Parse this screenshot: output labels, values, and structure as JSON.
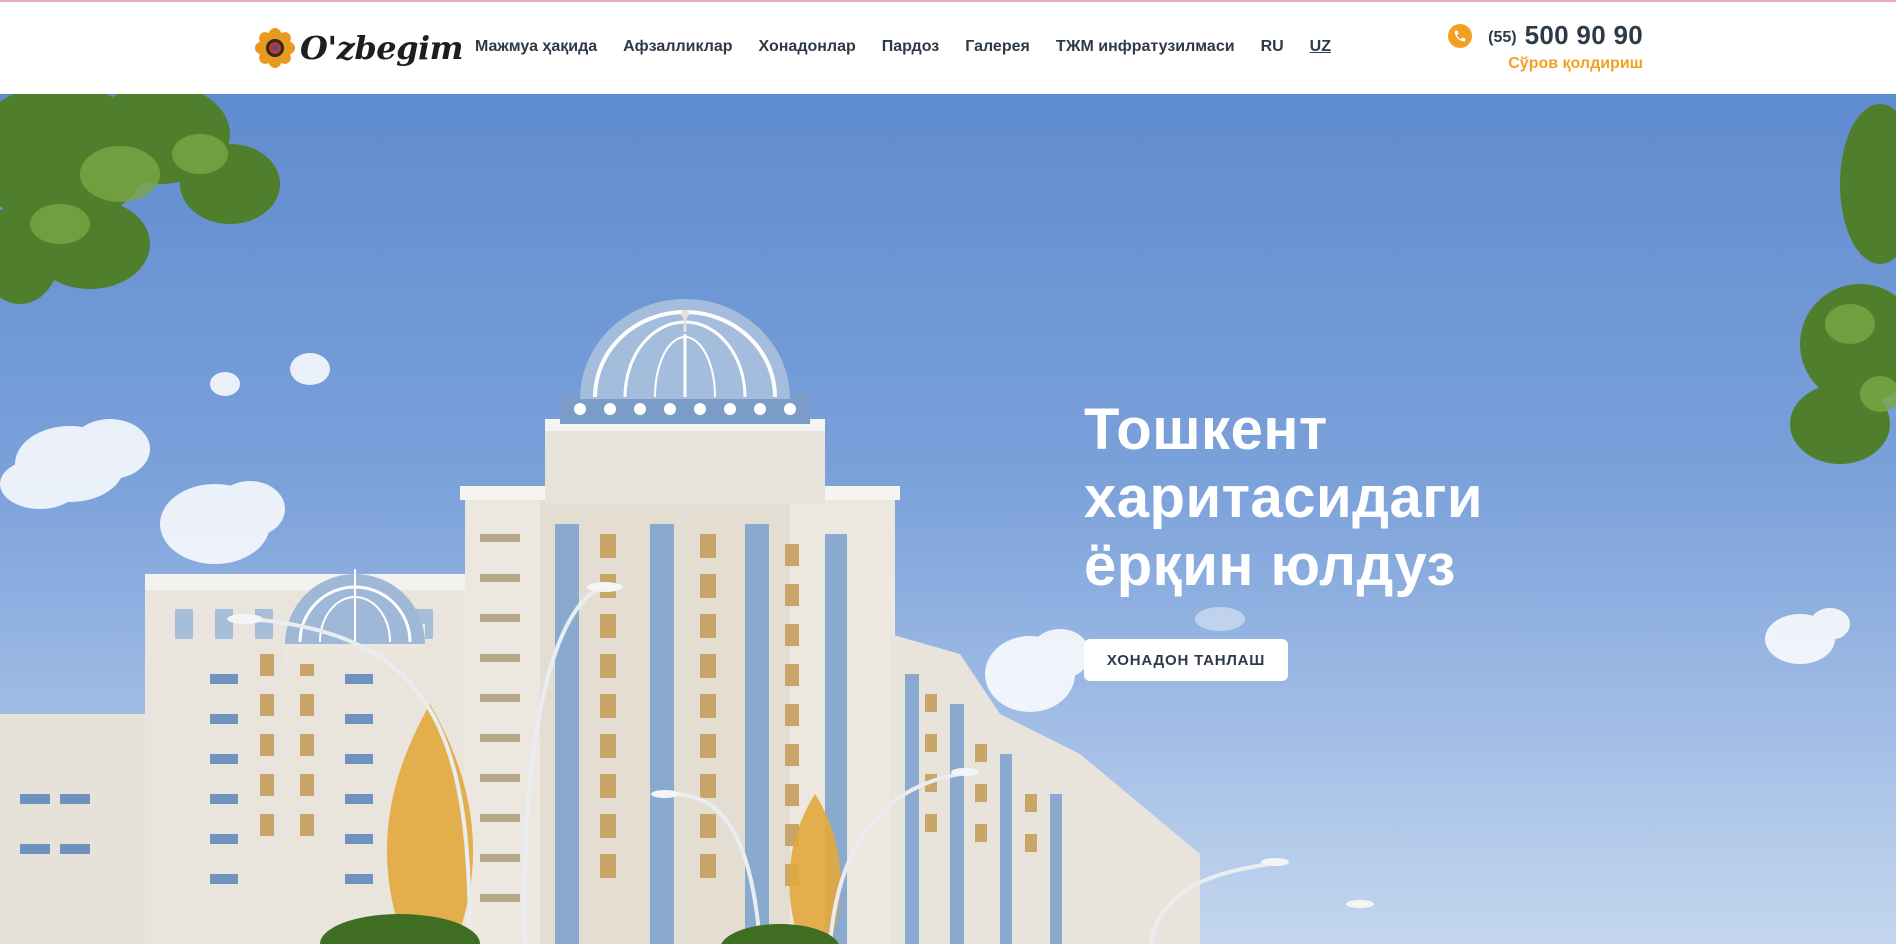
{
  "brand": {
    "logo_text": "O'zbegim",
    "logo_mark_icon": "flower-ornament-icon",
    "colors": {
      "accent": "#f0a123",
      "text_dark": "#2e3a47",
      "topline": "#e7a9b6"
    }
  },
  "nav": {
    "items": [
      {
        "label": "Мажмуа ҳақида"
      },
      {
        "label": "Афзалликлар"
      },
      {
        "label": "Хонадонлар"
      },
      {
        "label": "Пардоз"
      },
      {
        "label": "Галерея"
      },
      {
        "label": "ТЖМ инфратузилмаси"
      },
      {
        "label": "RU"
      },
      {
        "label": "UZ",
        "active": true
      }
    ]
  },
  "contact": {
    "phone_icon": "phone-icon",
    "phone_code": "(55)",
    "phone_number": "500 90 90",
    "request_label": "Сўров қолдириш"
  },
  "hero": {
    "title_lines": [
      "Тошкент",
      "харитасидаги",
      "ёрқин юлдуз"
    ],
    "cta_label": "ХОНАДОН ТАНЛАШ",
    "background_image": "residential-complex-render"
  }
}
